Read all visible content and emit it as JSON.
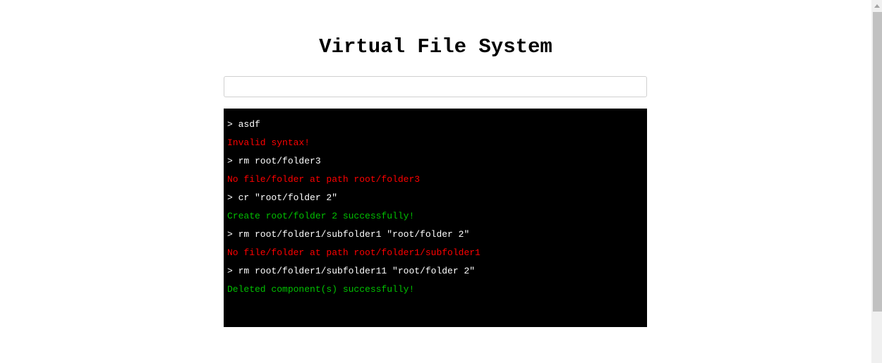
{
  "title": "Virtual File System",
  "input": {
    "value": "",
    "placeholder": ""
  },
  "colors": {
    "command": "#ffffff",
    "error": "#ff0000",
    "success": "#00c000"
  },
  "terminal": [
    {
      "text": "> asdf",
      "type": "command"
    },
    {
      "text": "Invalid syntax!",
      "type": "error"
    },
    {
      "text": "> rm root/folder3",
      "type": "command"
    },
    {
      "text": "No file/folder at path root/folder3",
      "type": "error"
    },
    {
      "text": "> cr \"root/folder 2\"",
      "type": "command"
    },
    {
      "text": "Create root/folder 2 successfully!",
      "type": "success"
    },
    {
      "text": "> rm root/folder1/subfolder1 \"root/folder 2\"",
      "type": "command"
    },
    {
      "text": "No file/folder at path root/folder1/subfolder1",
      "type": "error"
    },
    {
      "text": "> rm root/folder1/subfolder11 \"root/folder 2\"",
      "type": "command"
    },
    {
      "text": "Deleted component(s) successfully!",
      "type": "success"
    }
  ]
}
